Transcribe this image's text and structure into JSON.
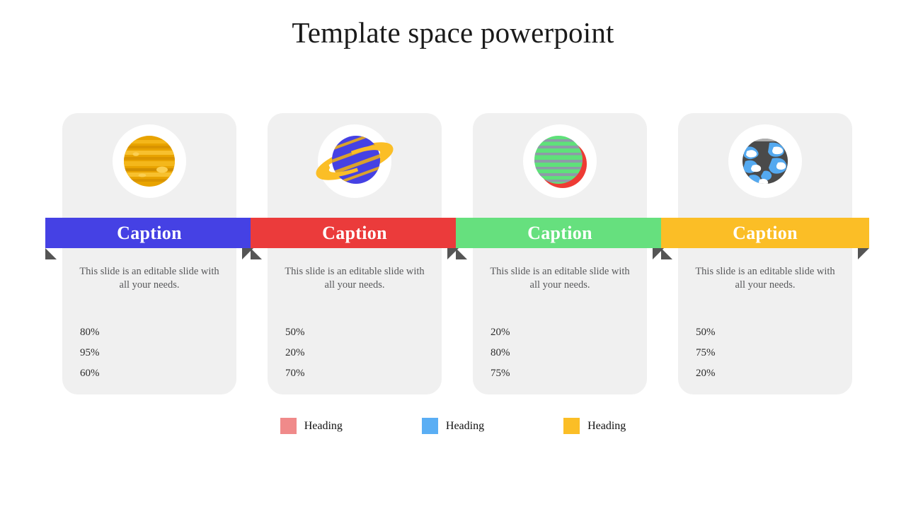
{
  "slide": {
    "title": "Template space powerpoint",
    "background": "#ffffff",
    "card_background": "#f0f0f0",
    "fold_color": "#555555"
  },
  "series_colors": {
    "pink": "#f08a8a",
    "blue": "#5aaef4",
    "yellow": "#fbbe26"
  },
  "cards": [
    {
      "icon": "planet-jupiter-icon",
      "caption": "Caption",
      "caption_color": "#4541e4",
      "description": "This slide is an editable slide with all your needs.",
      "bars": [
        {
          "label": "80%",
          "value": 80,
          "color": "#f08a8a"
        },
        {
          "label": "95%",
          "value": 95,
          "color": "#5aaef4"
        },
        {
          "label": "60%",
          "value": 60,
          "color": "#fbbe26"
        }
      ]
    },
    {
      "icon": "planet-saturn-icon",
      "caption": "Caption",
      "caption_color": "#eb3b3b",
      "description": "This slide is an editable slide with all your needs.",
      "bars": [
        {
          "label": "50%",
          "value": 50,
          "color": "#f08a8a"
        },
        {
          "label": "20%",
          "value": 20,
          "color": "#5aaef4"
        },
        {
          "label": "70%",
          "value": 70,
          "color": "#fbbe26"
        }
      ]
    },
    {
      "icon": "planet-green-striped-icon",
      "caption": "Caption",
      "caption_color": "#66e07e",
      "description": "This slide is an editable slide with all your needs.",
      "bars": [
        {
          "label": "20%",
          "value": 20,
          "color": "#f08a8a"
        },
        {
          "label": "80%",
          "value": 80,
          "color": "#5aaef4"
        },
        {
          "label": "75%",
          "value": 75,
          "color": "#fbbe26"
        }
      ]
    },
    {
      "icon": "planet-earth-icon",
      "caption": "Caption",
      "caption_color": "#fbbe26",
      "description": "This slide is an editable slide with all your needs.",
      "bars": [
        {
          "label": "50%",
          "value": 50,
          "color": "#f08a8a"
        },
        {
          "label": "75%",
          "value": 75,
          "color": "#5aaef4"
        },
        {
          "label": "20%",
          "value": 20,
          "color": "#fbbe26"
        }
      ]
    }
  ],
  "legend": [
    {
      "label": "Heading",
      "color": "#f08a8a"
    },
    {
      "label": "Heading",
      "color": "#5aaef4"
    },
    {
      "label": "Heading",
      "color": "#fbbe26"
    }
  ],
  "chart_data": {
    "type": "bar",
    "title": "Template space powerpoint",
    "xlabel": "",
    "ylabel": "",
    "xlim": [
      0,
      100
    ],
    "grid": false,
    "legend_position": "bottom",
    "categories": [
      "Caption 1",
      "Caption 2",
      "Caption 3",
      "Caption 4"
    ],
    "series": [
      {
        "name": "Heading",
        "color": "#f08a8a",
        "values": [
          80,
          50,
          20,
          50
        ]
      },
      {
        "name": "Heading",
        "color": "#5aaef4",
        "values": [
          95,
          20,
          80,
          75
        ]
      },
      {
        "name": "Heading",
        "color": "#fbbe26",
        "values": [
          60,
          70,
          75,
          20
        ]
      }
    ],
    "units": "percent"
  }
}
